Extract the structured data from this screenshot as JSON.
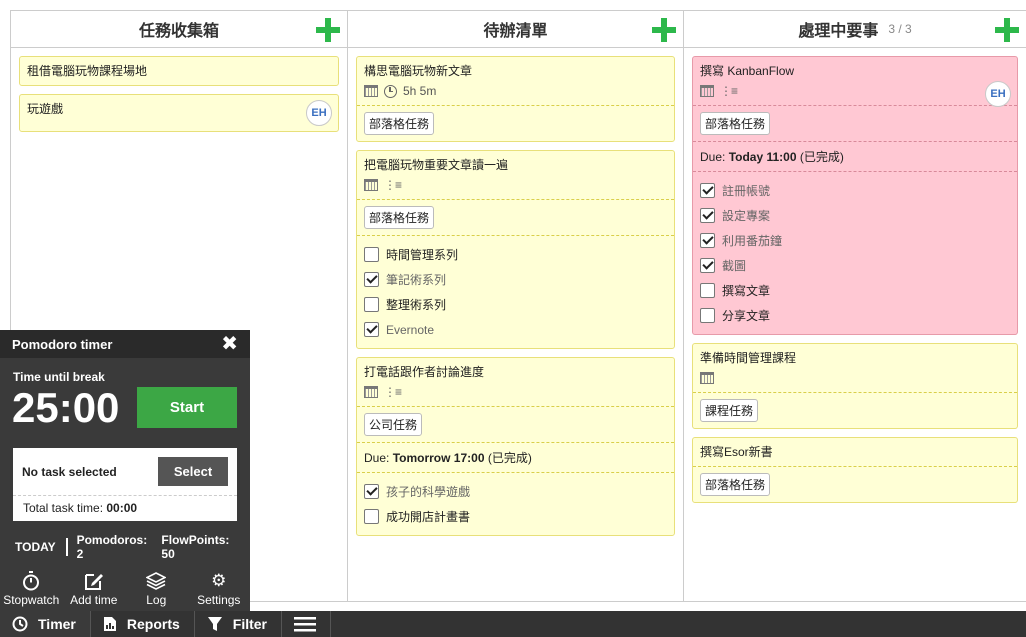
{
  "columns": [
    {
      "title": "任務收集箱",
      "count": "",
      "tasks": [
        {
          "title": "租借電腦玩物課程場地"
        },
        {
          "title": "玩遊戲",
          "avatar": "EH"
        }
      ]
    },
    {
      "title": "待辦清單",
      "count": "",
      "tasks": [
        {
          "title": "構思電腦玩物新文章",
          "time": "5h 5m",
          "tag": "部落格任務"
        },
        {
          "title": "把電腦玩物重要文章讀一遍",
          "tag": "部落格任務",
          "checklist": [
            {
              "label": "時間管理系列",
              "done": false
            },
            {
              "label": "筆記術系列",
              "done": true
            },
            {
              "label": "整理術系列",
              "done": false
            },
            {
              "label": "Evernote",
              "done": true
            }
          ]
        },
        {
          "title": "打電話跟作者討論進度",
          "tag": "公司任務",
          "due_prefix": "Due: ",
          "due_value": "Tomorrow 17:00",
          "due_suffix": " (已完成)",
          "checklist": [
            {
              "label": "孩子的科學遊戲",
              "done": true
            },
            {
              "label": "成功開店計畫書",
              "done": false
            }
          ]
        }
      ]
    },
    {
      "title": "處理中要事",
      "count": "3 / 3",
      "tasks": [
        {
          "title": "撰寫 KanbanFlow",
          "avatar": "EH",
          "tag": "部落格任務",
          "due_prefix": "Due: ",
          "due_value": "Today 11:00",
          "due_suffix": " (已完成)",
          "checklist": [
            {
              "label": "註冊帳號",
              "done": true
            },
            {
              "label": "設定專案",
              "done": true
            },
            {
              "label": "利用番茄鐘",
              "done": true
            },
            {
              "label": "截圖",
              "done": true
            },
            {
              "label": "撰寫文章",
              "done": false
            },
            {
              "label": "分享文章",
              "done": false
            }
          ]
        },
        {
          "title": "準備時間管理課程",
          "tag": "課程任務"
        },
        {
          "title": "撰寫Esor新書",
          "tag": "部落格任務"
        }
      ]
    }
  ],
  "pomodoro": {
    "title": "Pomodoro timer",
    "subtitle": "Time until break",
    "time": "25:00",
    "start_label": "Start",
    "no_task": "No task selected",
    "select_label": "Select",
    "total_label": "Total task time: ",
    "total_value": "00:00",
    "today_label": "TODAY",
    "pomodoros_label": "Pomodoros: ",
    "pomodoros_value": "2",
    "flowpoints_label": "FlowPoints: ",
    "flowpoints_value": "50",
    "tools": [
      "Stopwatch",
      "Add time",
      "Log",
      "Settings"
    ]
  },
  "bottombar": {
    "timer": "Timer",
    "reports": "Reports",
    "filter": "Filter"
  },
  "colors": {
    "task_yellow": "#ffffd6",
    "task_pink": "#ffc8d3",
    "add_green": "#2db84b",
    "start_green": "#3ca745"
  }
}
